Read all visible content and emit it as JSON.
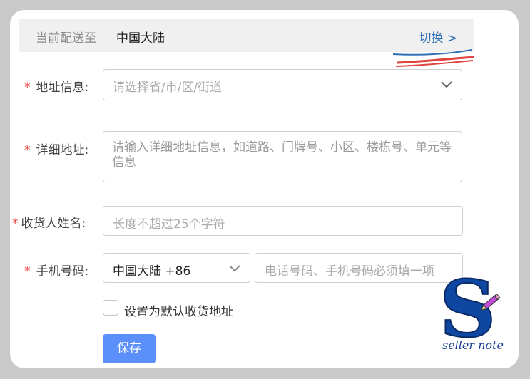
{
  "region": {
    "label": "当前配送至",
    "value": "中国大陆",
    "switch_label": "切换 >"
  },
  "form": {
    "address": {
      "required_mark": "*",
      "label": "地址信息:",
      "placeholder": "请选择省/市/区/街道"
    },
    "detail": {
      "required_mark": "*",
      "label": "详细地址:",
      "placeholder": "请输入详细地址信息，如道路、门牌号、小区、楼栋号、单元等信息"
    },
    "receiver": {
      "required_mark": "*",
      "label": "收货人姓名:",
      "placeholder": "长度不超过25个字符"
    },
    "phone": {
      "required_mark": "*",
      "label": "手机号码:",
      "country_code": "中国大陆 +86",
      "placeholder": "电话号码、手机号码必须填一项"
    },
    "default_checkbox_label": "设置为默认收货地址",
    "save_label": "保存"
  },
  "watermark": {
    "letter": "S",
    "text": "seller note"
  },
  "colors": {
    "accent": "#5b8ff9",
    "link": "#2f6fb5",
    "required": "#e0443e",
    "watermark": "#1a3d8f"
  }
}
